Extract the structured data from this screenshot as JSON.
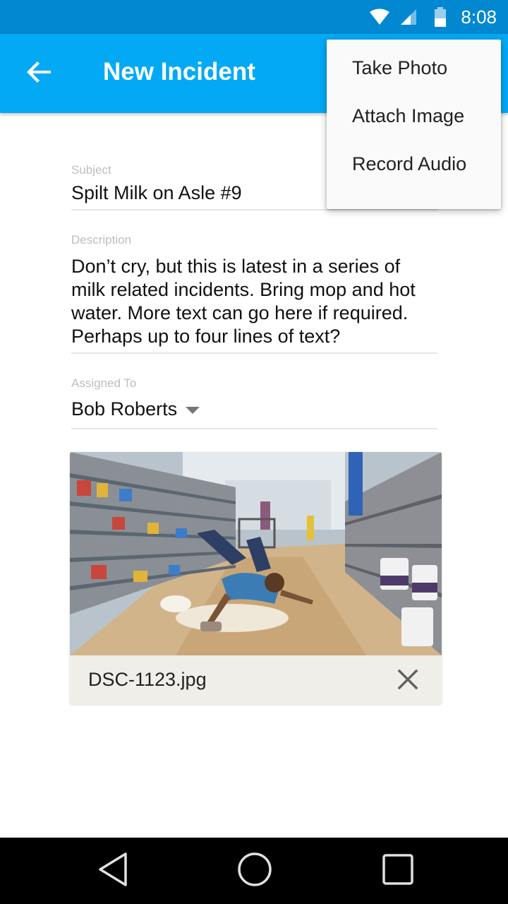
{
  "status_bar": {
    "time": "8:08",
    "icons": [
      "wifi-icon",
      "cell-signal-icon",
      "battery-icon"
    ],
    "background": "#0288d1"
  },
  "app_bar": {
    "title": "New Incident",
    "back_icon": "arrow-back-icon",
    "background": "#03a9f4"
  },
  "form": {
    "subject": {
      "label": "Subject",
      "value": "Spilt Milk on Asle #9"
    },
    "description": {
      "label": "Description",
      "value": "Don’t cry, but this is latest in a series of milk related incidents. Bring mop and hot water. More text can go here if required. Perhaps up to four lines of text?"
    },
    "assigned_to": {
      "label": "Assigned To",
      "value": "Bob Roberts"
    }
  },
  "attachment": {
    "filename": "DSC-1123.jpg",
    "remove_icon": "close-icon",
    "footer_color": "#efeee8"
  },
  "overflow_menu": {
    "items": [
      {
        "label": "Take Photo"
      },
      {
        "label": "Attach Image"
      },
      {
        "label": "Record Audio"
      }
    ]
  },
  "nav_bar": {
    "buttons": [
      "back-triangle-icon",
      "home-circle-icon",
      "recents-square-icon"
    ]
  }
}
